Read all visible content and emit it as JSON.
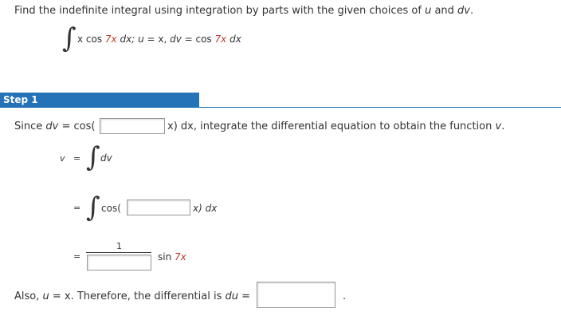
{
  "problem": {
    "instruction_prefix": "Find the indefinite integral using integration by parts with the given choices of ",
    "instruction_u": "u",
    "instruction_and": " and ",
    "instruction_dv": "dv",
    "instruction_end": ".",
    "integral_sign": "∫",
    "expr_x": "x cos ",
    "expr_7x": "7x",
    "expr_dx": " dx; ",
    "expr_u": "u",
    "expr_eq1": " = x, ",
    "expr_dv": "dv",
    "expr_eq2": " = cos ",
    "expr_7x_2": "7x",
    "expr_dx2": " dx"
  },
  "step": {
    "label": "Step 1"
  },
  "line1": {
    "prefix": "Since ",
    "dv": "dv",
    "eq": " = cos(",
    "input_value": "",
    "suffix_a": "x) dx, integrate the differential equation to obtain the function ",
    "v": "v",
    "suffix_b": "."
  },
  "line2": {
    "v": "v",
    "eq": "=",
    "integral_sign": "∫",
    "dv": "dv"
  },
  "line3": {
    "eq": "=",
    "integral_sign": "∫",
    "cos": "cos(",
    "input_value": "",
    "suffix": "x) dx"
  },
  "line4": {
    "eq": "=",
    "numerator": "1",
    "denominator_value": "",
    "sin": "sin ",
    "sin_arg": "7x"
  },
  "line5": {
    "prefix": "Also, ",
    "u": "u",
    "mid": " = x. Therefore, the differential is ",
    "du": "du",
    "eq": " =",
    "input_value": "",
    "end": "."
  },
  "colors": {
    "step_bar": "#2472b8",
    "highlight_red": "#c0392b",
    "text": "#333333"
  }
}
